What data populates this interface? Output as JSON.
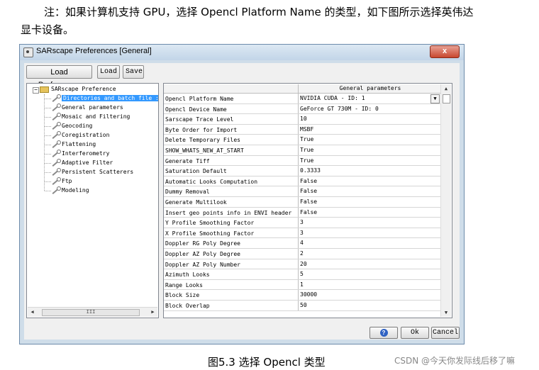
{
  "document": {
    "note_line1": "注：如果计算机支持 GPU，选择 Opencl Platform Name 的类型，如下图所示选择英伟达",
    "note_line2": "显卡设备。",
    "caption": "图5.3    选择 Opencl 类型",
    "watermark": "CSDN @今天你发际线后移了嘛"
  },
  "window": {
    "title": "SARscape Preferences [General]",
    "close_label": "x",
    "toolbar": {
      "load_preferences_label": "Load Preferences",
      "load_label": "Load",
      "save_label": "Save"
    }
  },
  "tree": {
    "root_label": "SARscape Preference",
    "expander": "−",
    "items": [
      {
        "label": "Directories and batch file :"
      },
      {
        "label": "General parameters"
      },
      {
        "label": "Mosaic and Filtering"
      },
      {
        "label": "Geocoding"
      },
      {
        "label": "Coregistration"
      },
      {
        "label": "Flattening"
      },
      {
        "label": "Interferometry"
      },
      {
        "label": "Adaptive Filter"
      },
      {
        "label": "Persistent Scatterers"
      },
      {
        "label": "Ftp"
      },
      {
        "label": "Modeling"
      }
    ],
    "scroll_left": "◀",
    "scroll_right": "▶",
    "scroll_thumb": "III"
  },
  "grid": {
    "header": "General parameters",
    "rows": [
      {
        "name": "Opencl Platform Name",
        "value": "NVIDIA CUDA - ID: 1"
      },
      {
        "name": "Opencl Device Name",
        "value": "GeForce GT 730M - ID: 0"
      },
      {
        "name": "Sarscape Trace Level",
        "value": "10"
      },
      {
        "name": "Byte Order for Import",
        "value": "MSBF"
      },
      {
        "name": "Delete Temporary Files",
        "value": "True"
      },
      {
        "name": "SHOW_WHATS_NEW_AT_START",
        "value": "True"
      },
      {
        "name": "Generate Tiff",
        "value": "True"
      },
      {
        "name": "Saturation Default",
        "value": "0.3333"
      },
      {
        "name": "Automatic Looks Computation",
        "value": "False"
      },
      {
        "name": "Dummy Removal",
        "value": "False"
      },
      {
        "name": "Generate Multilook",
        "value": "False"
      },
      {
        "name": "Insert geo points info in ENVI header",
        "value": "False"
      },
      {
        "name": "Y Profile Smoothing Factor",
        "value": "3"
      },
      {
        "name": "X Profile Smoothing Factor",
        "value": "3"
      },
      {
        "name": "Doppler RG Poly Degree",
        "value": "4"
      },
      {
        "name": "Doppler AZ Poly Degree",
        "value": "2"
      },
      {
        "name": "Doppler AZ Poly Number",
        "value": "20"
      },
      {
        "name": "Azimuth Looks",
        "value": "5"
      },
      {
        "name": "Range Looks",
        "value": "1"
      },
      {
        "name": "Block Size",
        "value": "30000"
      },
      {
        "name": "Block Overlap",
        "value": "50"
      }
    ],
    "combo_arrow": "▼",
    "scroll_up": "▲",
    "scroll_down": "▼"
  },
  "footer": {
    "help_glyph": "?",
    "ok_label": "Ok",
    "cancel_label": "Cancel"
  },
  "colors": {
    "selection": "#3399ff",
    "window_frame": "#cfdde9",
    "close_button": "#c8472f"
  }
}
